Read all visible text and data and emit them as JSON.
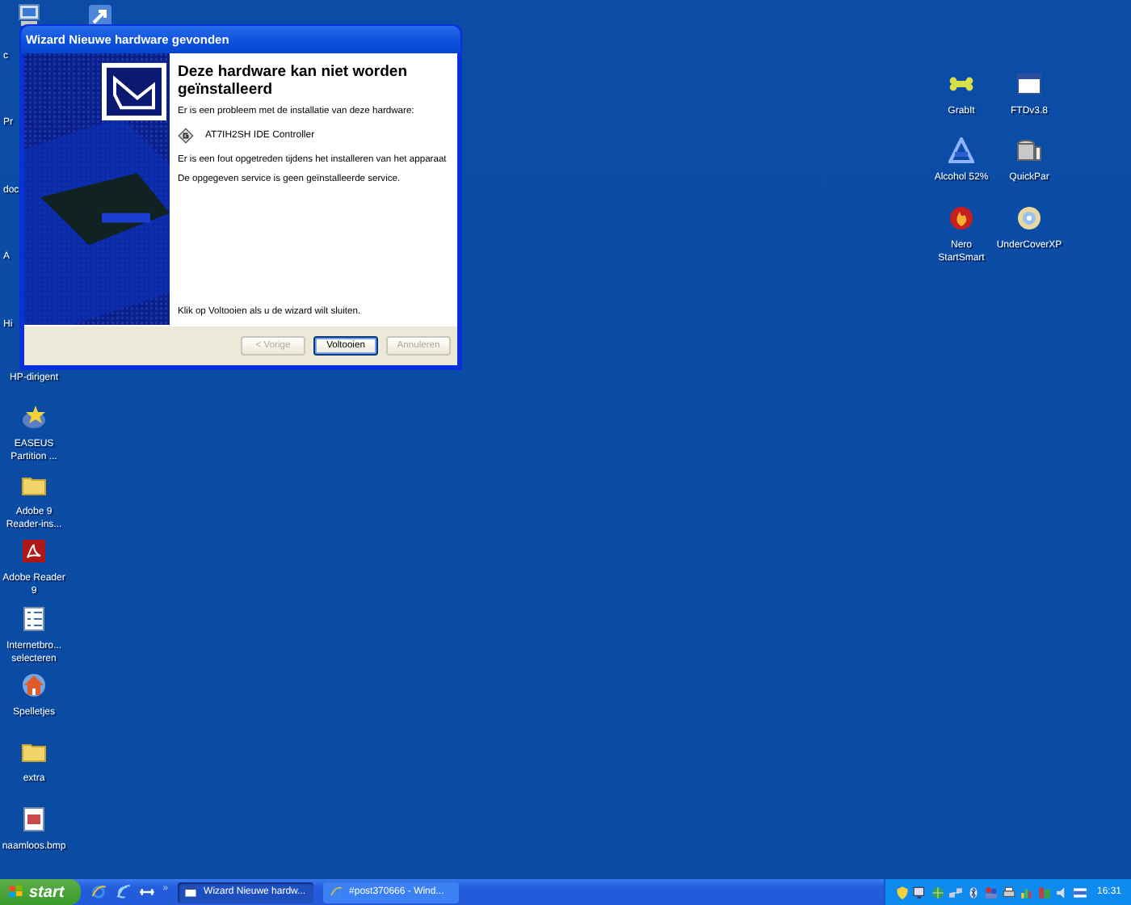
{
  "desktop": {
    "left_icons": [
      {
        "label": "c",
        "kind": "covered"
      },
      {
        "label": "Pr",
        "kind": "covered"
      },
      {
        "label": "doc",
        "kind": "covered"
      },
      {
        "label": "A",
        "kind": "covered"
      },
      {
        "label": "Hi",
        "kind": "covered"
      },
      {
        "label": "HP-dirigent",
        "kind": "label-only"
      },
      {
        "label": "EASEUS Partition ...",
        "kind": "disk-star"
      },
      {
        "label": "Adobe 9 Reader-ins...",
        "kind": "folder"
      },
      {
        "label": "Adobe Reader 9",
        "kind": "pdf"
      },
      {
        "label": "Internetbro... selecteren",
        "kind": "list"
      },
      {
        "label": "Spelletjes",
        "kind": "house"
      },
      {
        "label": "extra",
        "kind": "folder"
      },
      {
        "label": "naamloos.bmp",
        "kind": "image"
      }
    ],
    "top_icons": [
      {
        "kind": "computer"
      },
      {
        "kind": "shortcut"
      }
    ],
    "right_icons": [
      {
        "label": "GrabIt",
        "kind": "bone"
      },
      {
        "label": "FTDv3.8",
        "kind": "window"
      },
      {
        "label": "Alcohol 52%",
        "kind": "alcohol"
      },
      {
        "label": "QuickPar",
        "kind": "drives"
      },
      {
        "label": "Nero StartSmart",
        "kind": "flame"
      },
      {
        "label": "UnderCoverXP",
        "kind": "disc"
      }
    ]
  },
  "dialog": {
    "title": "Wizard Nieuwe hardware gevonden",
    "heading": "Deze hardware kan niet worden geïnstalleerd",
    "intro": "Er is een probleem met de installatie van deze hardware:",
    "device": "AT7IH2SH IDE Controller",
    "error": "Er is een fout opgetreden tijdens het installeren van het apparaat",
    "detail": "De opgegeven service is geen geïnstalleerde service.",
    "finish_hint": "Klik op Voltooien als u de wizard wilt sluiten.",
    "buttons": [
      {
        "label": "< Vorige",
        "disabled": true,
        "default": false
      },
      {
        "label": "Voltooien",
        "disabled": false,
        "default": true
      },
      {
        "label": "Annuleren",
        "disabled": true,
        "default": false
      }
    ]
  },
  "taskbar": {
    "start": "start",
    "quick_launch": [
      {
        "kind": "ie"
      },
      {
        "kind": "ie-outline"
      },
      {
        "kind": "connector"
      }
    ],
    "overflow": "»",
    "tasks": [
      {
        "label": "Wizard Nieuwe hardw...",
        "kind": "window",
        "selected": true
      },
      {
        "label": "#post370666 - Wind...",
        "kind": "ie",
        "selected": false
      }
    ],
    "tray_icons": [
      {
        "kind": "shield"
      },
      {
        "kind": "monitor"
      },
      {
        "kind": "globe"
      },
      {
        "kind": "network"
      },
      {
        "kind": "bluetooth"
      },
      {
        "kind": "people"
      },
      {
        "kind": "printer"
      },
      {
        "kind": "chart"
      },
      {
        "kind": "bars"
      },
      {
        "kind": "speaker"
      },
      {
        "kind": "flag"
      }
    ],
    "clock": "16:31"
  }
}
